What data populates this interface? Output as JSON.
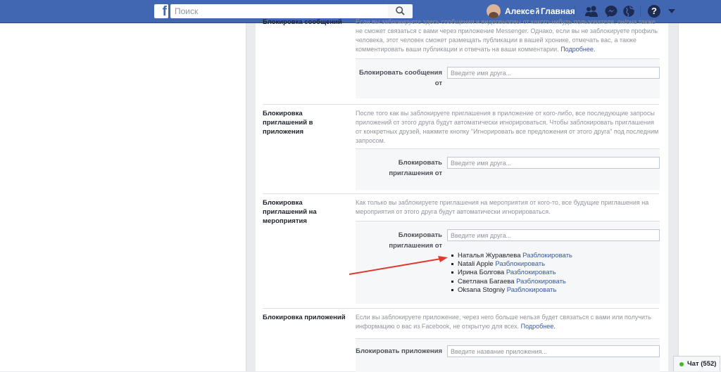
{
  "topbar": {
    "logo_letter": "f",
    "search_placeholder": "Поиск",
    "profile_name": "Алексей",
    "home_label": "Главная",
    "help_label": "?",
    "icons": [
      "friends-icon",
      "messenger-icon",
      "notifications-globe-icon",
      "help-icon",
      "account-menu-caret-icon"
    ]
  },
  "sections": {
    "messages": {
      "title": "Блокировка сообщений",
      "description_lines": [
        "Если вы заблокируете здесь сообщения и видеовызовы от какого-нибудь пользователя, он/она также",
        "не сможет связаться с вами через приложение Messenger. Однако, если вы не заблокируете профиль",
        "человека, этот человек сможет размещать публикации в вашей хронике, отмечать вас, а также",
        "комментировать ваши публикации и отвечать на ваши комментарии."
      ],
      "more_link": "Подробнее.",
      "field_label": "Блокировать сообщения от",
      "input_placeholder": "Введите имя друга..."
    },
    "app_invites": {
      "title": "Блокировка приглашений в приложения",
      "description_lines": [
        "После того как вы заблокируете приглашения в приложение от кого-либо, все последующие запросы",
        "приложений от этого друга будут автоматически игнорироваться. Чтобы заблокировать приглашения",
        "от конкретных друзей, нажмите кнопку \"Игнорировать все предложения от этого друга\" под последним",
        "запросом."
      ],
      "field_label": "Блокировать приглашения от",
      "input_placeholder": "Введите имя друга..."
    },
    "event_invites": {
      "title": "Блокировка приглашений на мероприятия",
      "description_lines": [
        "Как только вы заблокируете приглашения на мероприятия от кого-то, все будущие приглашения на",
        "мероприятия от этого друга будут автоматически игнорироваться."
      ],
      "field_label": "Блокировать приглашения от",
      "input_placeholder": "Введите имя друга...",
      "unblock_label": "Разблокировать",
      "blocked": [
        {
          "name": "Наталья Журавлева"
        },
        {
          "name": "Natali Apple"
        },
        {
          "name": "Ирина Болгова"
        },
        {
          "name": "Светлана Багаева"
        },
        {
          "name": "Oksana Stogniy"
        }
      ]
    },
    "apps": {
      "title": "Блокировка приложений",
      "description_lines": [
        "Если вы заблокируете приложение, через него больше нельзя будет связаться с вами или получить",
        "информацию о вас из Facebook, не открытую для всех."
      ],
      "more_link": "Подробнее.",
      "field_label": "Блокировать приложения",
      "input_placeholder": "Введите название приложения..."
    }
  },
  "chat": {
    "label": "Чат (552)"
  },
  "colors": {
    "brand_blue": "#4267b2",
    "link": "#365899",
    "annotation_arrow": "#e03a2f",
    "online": "#42b72a"
  }
}
